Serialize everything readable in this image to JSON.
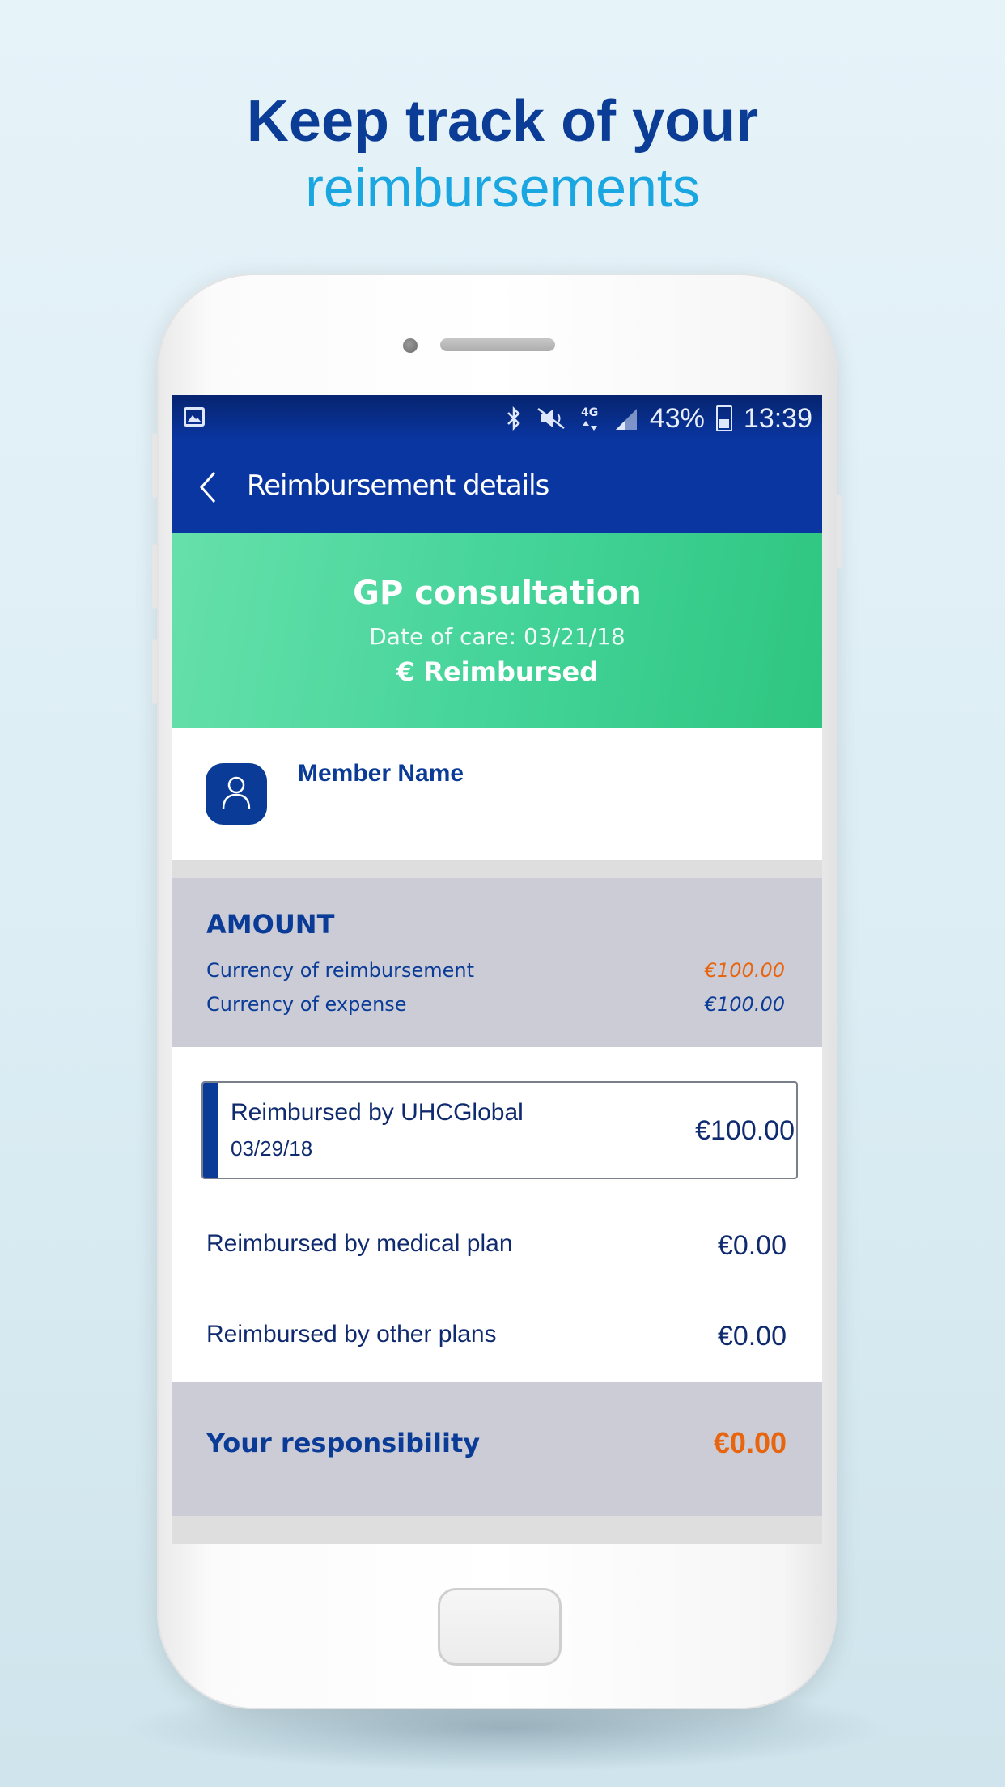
{
  "headline": {
    "line1": "Keep track of your",
    "line2": "reimbursements"
  },
  "status_bar": {
    "network": "4G",
    "battery": "43%",
    "time": "13:39",
    "icons": [
      "gallery-icon",
      "bluetooth-icon",
      "mute-icon",
      "signal-icon",
      "battery-icon"
    ]
  },
  "app_bar": {
    "back_icon": "chevron-left-icon",
    "title": "Reimbursement details"
  },
  "claim": {
    "title": "GP consultation",
    "date": "Date of care: 03/21/18",
    "status": "€ Reimbursed"
  },
  "member": {
    "name": "Member Name",
    "avatar_icon": "person-icon"
  },
  "amount": {
    "title": "AMOUNT",
    "rows": [
      {
        "label": "Currency of reimbursement",
        "value": "€100.00"
      },
      {
        "label": "Currency of expense",
        "value": "€100.00"
      }
    ]
  },
  "uhc": {
    "title": "Reimbursed by UHCGlobal",
    "date": "03/29/18",
    "amount": "€100.00"
  },
  "other_rows": [
    {
      "label": "Reimbursed by medical plan",
      "value": "€0.00"
    },
    {
      "label": "Reimbursed by other plans",
      "value": "€0.00"
    }
  ],
  "responsibility": {
    "label": "Your responsibility",
    "value": "€0.00"
  },
  "colors": {
    "brand_blue": "#0a36a2",
    "accent_green": "#45d49a",
    "accent_orange": "#e8650f",
    "light_blue": "#1aa6e0"
  }
}
